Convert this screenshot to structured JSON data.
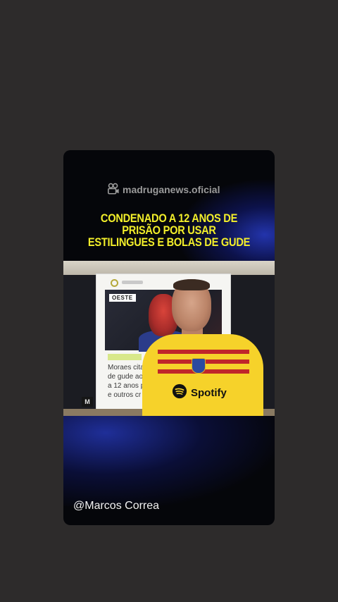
{
  "story": {
    "watermark": "madruganews.oficial",
    "headline_lines": [
      "CONDENADO A 12 ANOS DE",
      "PRISÃO POR USAR",
      "ESTILINGUES E BOLAS DE GUDE"
    ],
    "username": "@Marcos Correa",
    "accent_color": "#f3ef2a"
  },
  "video": {
    "screen_tag": "OESTE",
    "screen_text_lines": [
      "Moraes cita",
      "de gude ao",
      "a 12 anos p",
      "e outros cr"
    ],
    "channel_logo": "M",
    "sponsor_label": "Spotify",
    "shirt_colors": {
      "base": "#f6d22a",
      "stripes": "#c0262a"
    }
  },
  "icons": {
    "watermark_icon": "camera-reel-icon",
    "sponsor_icon": "spotify-icon"
  }
}
